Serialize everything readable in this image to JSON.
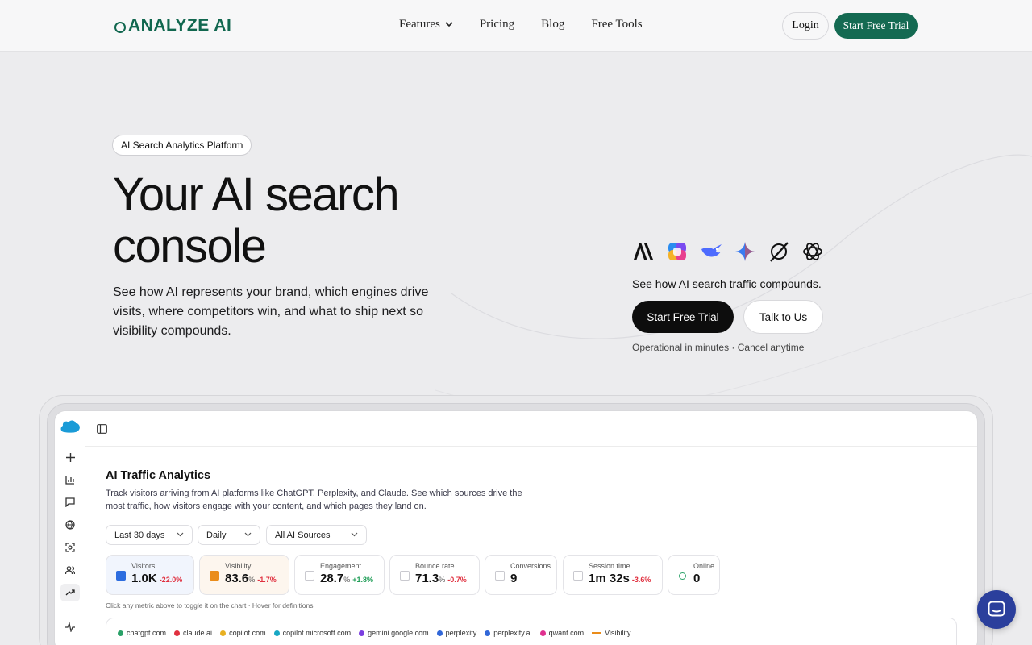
{
  "header": {
    "logo_text": "ANALYZE AI",
    "nav": [
      "Features",
      "Pricing",
      "Blog",
      "Free Tools"
    ],
    "login_label": "Login",
    "trial_label": "Start Free Trial",
    "brand_color": "#146a52"
  },
  "hero": {
    "badge": "AI Search Analytics Platform",
    "title_line1": "Your AI search",
    "title_line2": "console",
    "subtitle": "See how AI represents your brand, which engines drive visits, where competitors win, and what to ship next so visibility compounds.",
    "ai_logos": [
      "anthropic-icon",
      "copilot-icon",
      "deepseek-icon",
      "gemini-icon",
      "grok-icon",
      "openai-icon"
    ],
    "right_sub": "See how AI search traffic compounds.",
    "cta_primary": "Start Free Trial",
    "cta_secondary": "Talk to Us",
    "note": "Operational in minutes · Cancel anytime"
  },
  "app": {
    "title": "AI Traffic Analytics",
    "description": "Track visitors arriving from AI platforms like ChatGPT, Perplexity, and Claude. See which sources drive the most traffic, how visitors engage with your content, and which pages they land on.",
    "filters": [
      "Last 30 days",
      "Daily",
      "All AI Sources"
    ],
    "metrics": [
      {
        "label": "Visitors",
        "value": "1.0K",
        "unit": "",
        "change": "-22.0%",
        "trend": "neg",
        "checked": "blue"
      },
      {
        "label": "Visibility",
        "value": "83.6",
        "unit": "%",
        "change": "-1.7%",
        "trend": "neg",
        "checked": "orange"
      },
      {
        "label": "Engagement",
        "value": "28.7",
        "unit": "%",
        "change": "+1.8%",
        "trend": "pos",
        "checked": ""
      },
      {
        "label": "Bounce rate",
        "value": "71.3",
        "unit": "%",
        "change": "-0.7%",
        "trend": "neg",
        "checked": ""
      },
      {
        "label": "Conversions",
        "value": "9",
        "unit": "",
        "change": "",
        "trend": "",
        "checked": ""
      },
      {
        "label": "Session time",
        "value": "1m 32s",
        "unit": "",
        "change": "-3.6%",
        "trend": "neg",
        "checked": ""
      },
      {
        "label": "Online",
        "value": "0",
        "unit": "",
        "change": "",
        "trend": "",
        "checked": "circle"
      }
    ],
    "hint": "Click any metric above to toggle it on the chart · Hover for definitions",
    "legend": [
      {
        "label": "chatgpt.com",
        "color": "#2aa168",
        "kind": "dot"
      },
      {
        "label": "claude.ai",
        "color": "#e0303f",
        "kind": "dot"
      },
      {
        "label": "copilot.com",
        "color": "#e8b021",
        "kind": "dot"
      },
      {
        "label": "copilot.microsoft.com",
        "color": "#17a7c4",
        "kind": "dot"
      },
      {
        "label": "gemini.google.com",
        "color": "#7b3fe0",
        "kind": "dot"
      },
      {
        "label": "perplexity",
        "color": "#3167d8",
        "kind": "dot"
      },
      {
        "label": "perplexity.ai",
        "color": "#3167d8",
        "kind": "dot"
      },
      {
        "label": "qwant.com",
        "color": "#e0308f",
        "kind": "dot"
      },
      {
        "label": "Visibility",
        "color": "#ea8c1a",
        "kind": "dash"
      }
    ]
  }
}
